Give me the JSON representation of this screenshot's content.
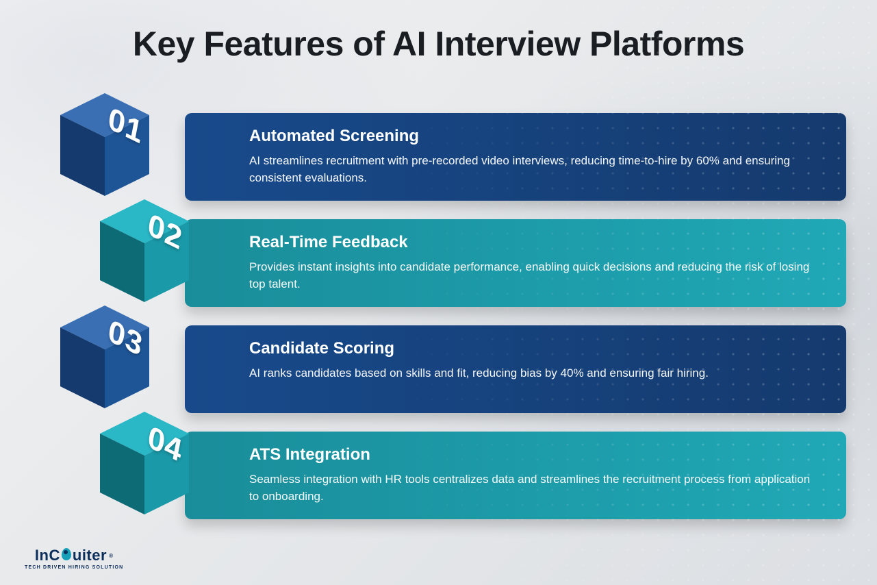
{
  "title": "Key Features of AI Interview Platforms",
  "features": [
    {
      "num": "01",
      "title": "Automated Screening",
      "desc": "AI streamlines recruitment with pre-recorded video interviews, reducing time-to-hire by 60% and ensuring consistent evaluations.",
      "scheme": "blue"
    },
    {
      "num": "02",
      "title": "Real-Time Feedback",
      "desc": "Provides instant insights into candidate performance, enabling quick decisions and reducing the risk of losing top talent.",
      "scheme": "teal"
    },
    {
      "num": "03",
      "title": "Candidate Scoring",
      "desc": "AI ranks candidates based on skills and fit, reducing bias by 40% and ensuring fair hiring.",
      "scheme": "blue"
    },
    {
      "num": "04",
      "title": "ATS Integration",
      "desc": "Seamless integration with HR tools centralizes data and streamlines the recruitment process from application to onboarding.",
      "scheme": "teal"
    }
  ],
  "colors": {
    "blue": {
      "top": "#3a6fb4",
      "left": "#153a6e",
      "right": "#1e5597",
      "panel": "blue-panel"
    },
    "teal": {
      "top": "#2ab7c6",
      "left": "#0d6b76",
      "right": "#1a99a8",
      "panel": "teal-panel"
    }
  },
  "logo": {
    "text_left": "InC",
    "text_right": "uiter",
    "tagline": "TECH DRIVEN HIRING SOLUTION",
    "registered": "®"
  }
}
